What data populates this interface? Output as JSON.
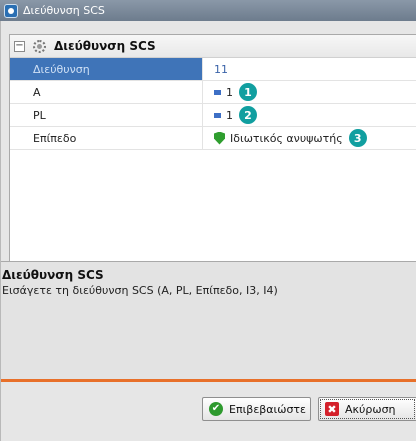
{
  "window": {
    "title": "Διεύθυνση SCS"
  },
  "group": {
    "title": "Διεύθυνση SCS",
    "collapse_glyph": "−"
  },
  "properties": [
    {
      "label": "Διεύθυνση",
      "value": "11",
      "badge": ""
    },
    {
      "label": "A",
      "value": "1",
      "badge": "1"
    },
    {
      "label": "PL",
      "value": "1",
      "badge": "2"
    },
    {
      "label": "Επίπεδο",
      "value": "Ιδιωτικός ανυψωτής",
      "badge": "3"
    }
  ],
  "description": {
    "title": "Διεύθυνση SCS",
    "text": "Εισάγετε τη διεύθυνση SCS (A, PL, Επίπεδο, I3, I4)"
  },
  "buttons": {
    "ok_label": "Επιβεβαιώστε",
    "cancel_label": "Ακύρωση"
  },
  "icons": {
    "ok_glyph": "✔",
    "cancel_glyph": "✖"
  },
  "colors": {
    "accent": "#e8702a",
    "selected_row": "#3f74b8",
    "badge": "#119fa0"
  }
}
